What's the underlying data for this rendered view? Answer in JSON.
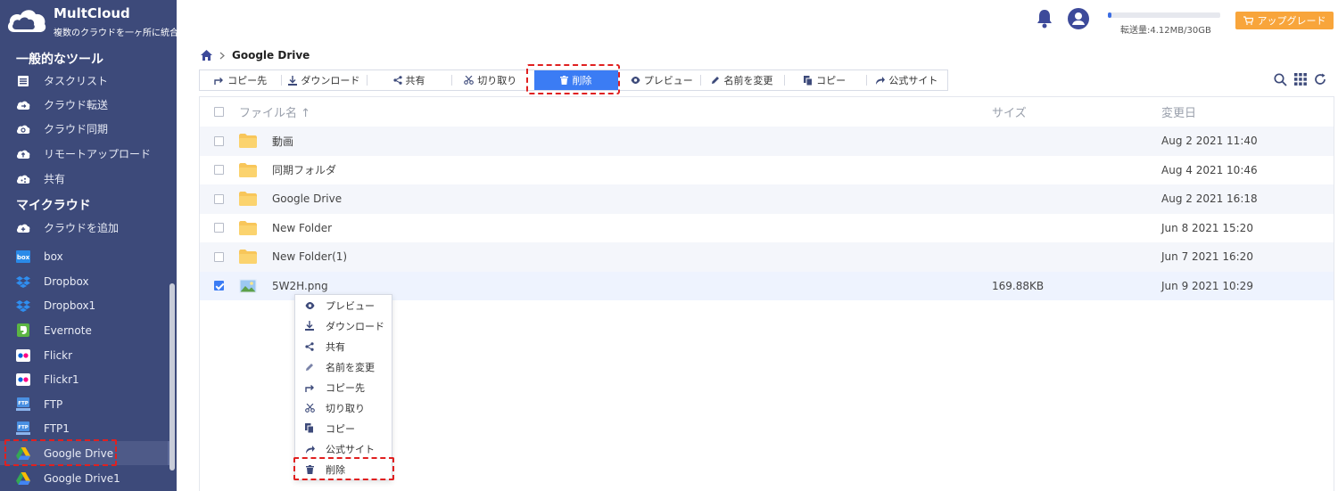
{
  "brand": {
    "name": "MultCloud",
    "tagline": "複数のクラウドを一ヶ所に統合"
  },
  "sidebar": {
    "tools_title": "一般的なツール",
    "tools": [
      {
        "label": "タスクリスト",
        "icon": "task-list-icon"
      },
      {
        "label": "クラウド転送",
        "icon": "cloud-transfer-icon"
      },
      {
        "label": "クラウド同期",
        "icon": "cloud-sync-icon"
      },
      {
        "label": "リモートアップロード",
        "icon": "remote-upload-icon"
      },
      {
        "label": "共有",
        "icon": "share-icon"
      }
    ],
    "mycloud_title": "マイクラウド",
    "add_cloud": "クラウドを追加",
    "clouds": [
      {
        "label": "box",
        "icon": "box-icon"
      },
      {
        "label": "Dropbox",
        "icon": "dropbox-icon"
      },
      {
        "label": "Dropbox1",
        "icon": "dropbox-icon"
      },
      {
        "label": "Evernote",
        "icon": "evernote-icon"
      },
      {
        "label": "Flickr",
        "icon": "flickr-icon"
      },
      {
        "label": "Flickr1",
        "icon": "flickr-icon"
      },
      {
        "label": "FTP",
        "icon": "ftp-icon"
      },
      {
        "label": "FTP1",
        "icon": "ftp-icon"
      },
      {
        "label": "Google Drive",
        "icon": "google-drive-icon"
      },
      {
        "label": "Google Drive1",
        "icon": "google-drive-icon"
      }
    ]
  },
  "header": {
    "usage_text": "転送量:4.12MB/30GB",
    "usage_fraction": 0.03,
    "upgrade_label": "アップグレード"
  },
  "breadcrumb": {
    "current": "Google Drive"
  },
  "toolbar": {
    "copy_to": "コピー先",
    "download": "ダウンロード",
    "share": "共有",
    "cut": "切り取り",
    "delete": "削除",
    "preview": "プレビュー",
    "rename": "名前を変更",
    "copy": "コピー",
    "official_site": "公式サイト"
  },
  "table": {
    "headers": {
      "name": "ファイル名",
      "size": "サイズ",
      "date": "変更日"
    },
    "rows": [
      {
        "name": "動画",
        "size": "",
        "date": "Aug 2 2021 11:40",
        "type": "folder"
      },
      {
        "name": "同期フォルダ",
        "size": "",
        "date": "Aug 4 2021 10:46",
        "type": "folder"
      },
      {
        "name": "Google Drive",
        "size": "",
        "date": "Aug 2 2021 16:18",
        "type": "folder"
      },
      {
        "name": "New Folder",
        "size": "",
        "date": "Jun 8 2021 15:20",
        "type": "folder"
      },
      {
        "name": "New Folder(1)",
        "size": "",
        "date": "Jun 7 2021 16:20",
        "type": "folder"
      },
      {
        "name": "5W2H.png",
        "size": "169.88KB",
        "date": "Jun 9 2021 10:29",
        "type": "image"
      }
    ]
  },
  "context_menu": {
    "items": [
      {
        "label": "プレビュー",
        "icon": "eye-icon"
      },
      {
        "label": "ダウンロード",
        "icon": "download-icon"
      },
      {
        "label": "共有",
        "icon": "share-icon"
      },
      {
        "label": "名前を変更",
        "icon": "pencil-icon"
      },
      {
        "label": "コピー先",
        "icon": "forward-arrow-icon"
      },
      {
        "label": "切り取り",
        "icon": "scissors-icon"
      },
      {
        "label": "コピー",
        "icon": "copy-icon"
      },
      {
        "label": "公式サイト",
        "icon": "share-arrow-icon"
      },
      {
        "label": "削除",
        "icon": "trash-icon"
      }
    ]
  },
  "colors": {
    "sidebar_bg": "#3d4a7a",
    "accent": "#3b7cf4",
    "upgrade": "#f8a53b",
    "highlight": "#e02020",
    "folder": "#f8c65a"
  }
}
